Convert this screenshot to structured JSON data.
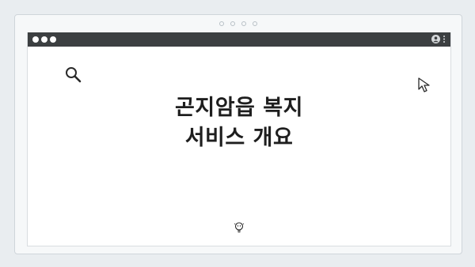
{
  "window": {
    "controls": [
      "close",
      "minimize",
      "maximize"
    ],
    "menu_icons": [
      "user-icon",
      "kebab-icon"
    ]
  },
  "page": {
    "title_line1": "곤지암읍 복지",
    "title_line2": "서비스 개요",
    "icons": [
      "search-icon",
      "cursor-arrow-icon",
      "lightbulb-icon"
    ]
  },
  "colors": {
    "background": "#e9edf0",
    "titlebar": "#3c3f41",
    "text": "#1e1e1e"
  }
}
